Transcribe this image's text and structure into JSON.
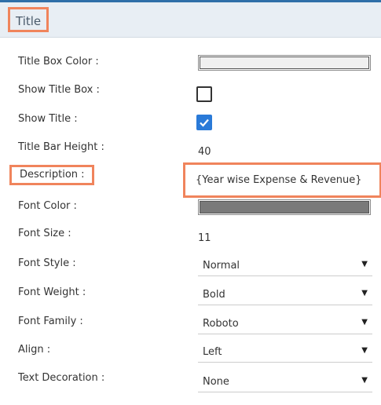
{
  "section": {
    "title": "Title"
  },
  "colors": {
    "title_box_color": "#f0f0f0",
    "font_color": "#7a7a7a",
    "highlight": "#f0845c",
    "checkbox_checked": "#2a7ad8"
  },
  "rows": {
    "title_box_color": {
      "label": "Title Box Color :"
    },
    "show_title_box": {
      "label": "Show Title Box :",
      "checked": false
    },
    "show_title": {
      "label": "Show Title :",
      "checked": true
    },
    "title_bar_height": {
      "label": "Title Bar Height :",
      "value": "40"
    },
    "description": {
      "label": "Description :",
      "value": "{Year wise Expense & Revenue}"
    },
    "font_color": {
      "label": "Font Color :"
    },
    "font_size": {
      "label": "Font Size :",
      "value": "11"
    },
    "font_style": {
      "label": "Font Style :",
      "value": "Normal"
    },
    "font_weight": {
      "label": "Font Weight :",
      "value": "Bold"
    },
    "font_family": {
      "label": "Font Family :",
      "value": "Roboto"
    },
    "align": {
      "label": "Align :",
      "value": "Left"
    },
    "text_decoration": {
      "label": "Text Decoration :",
      "value": "None"
    }
  },
  "icons": {
    "dropdown": "caret-down-icon",
    "checkmark": "checkmark-icon"
  },
  "caret_glyph": "▼"
}
